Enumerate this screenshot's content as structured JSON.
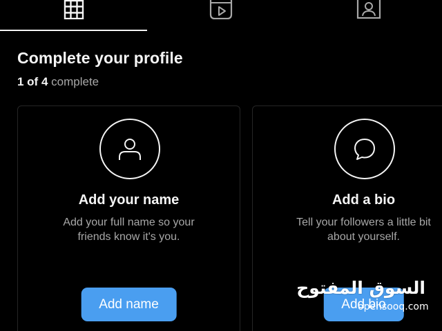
{
  "tabs": [
    {
      "icon": "grid-icon",
      "active": true
    },
    {
      "icon": "reels-icon",
      "active": false
    },
    {
      "icon": "tagged-icon",
      "active": false
    }
  ],
  "header": {
    "title": "Complete your profile",
    "progress_count": "1 of 4",
    "progress_suffix": "complete"
  },
  "cards": [
    {
      "icon": "user-icon",
      "title": "Add your name",
      "desc_line1": "Add your full name so your",
      "desc_line2": "friends know it's you.",
      "button": "Add name"
    },
    {
      "icon": "speech-bubble-icon",
      "title": "Add a bio",
      "desc_line1": "Tell your followers a little bit",
      "desc_line2": "about yourself.",
      "button": "Add bio"
    }
  ],
  "watermark": {
    "arabic": "السوق المفتوح",
    "latin": "opensooq.com"
  },
  "colors": {
    "background": "#000000",
    "accent_button": "#4a9ef0",
    "primary_text": "#f5f5f5",
    "secondary_text": "#a8a8a8",
    "card_border": "#262626"
  }
}
